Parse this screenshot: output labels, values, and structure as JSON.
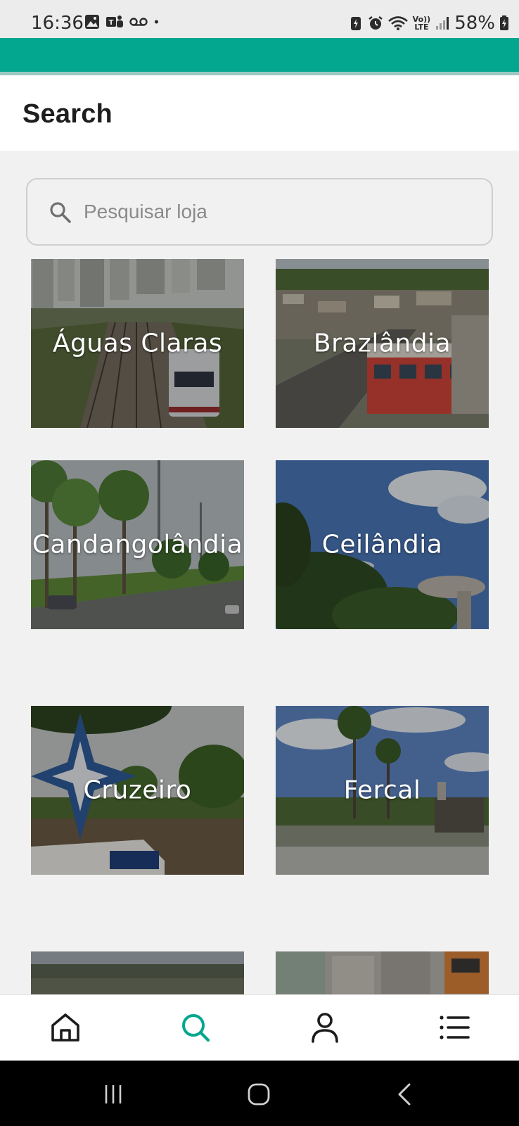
{
  "status_bar": {
    "time": "16:36",
    "battery": "58%",
    "lte_top": "Vo))",
    "lte_bottom": "LTE"
  },
  "header": {
    "title": "Search"
  },
  "search": {
    "placeholder": "Pesquisar loja",
    "value": ""
  },
  "stores": [
    {
      "name": "Águas Claras"
    },
    {
      "name": "Brazlândia"
    },
    {
      "name": "Candangolândia"
    },
    {
      "name": "Ceilândia"
    },
    {
      "name": "Cruzeiro"
    },
    {
      "name": "Fercal"
    },
    {
      "name": ""
    },
    {
      "name": ""
    }
  ],
  "bottom_nav": {
    "items": [
      {
        "icon": "home-icon",
        "active": false
      },
      {
        "icon": "search-icon",
        "active": true
      },
      {
        "icon": "user-icon",
        "active": false
      },
      {
        "icon": "list-icon",
        "active": false
      }
    ],
    "active_color": "#03a68e",
    "inactive_color": "#1c1c1c"
  },
  "colors": {
    "brand": "#03a68e",
    "background": "#f1f1f1"
  }
}
